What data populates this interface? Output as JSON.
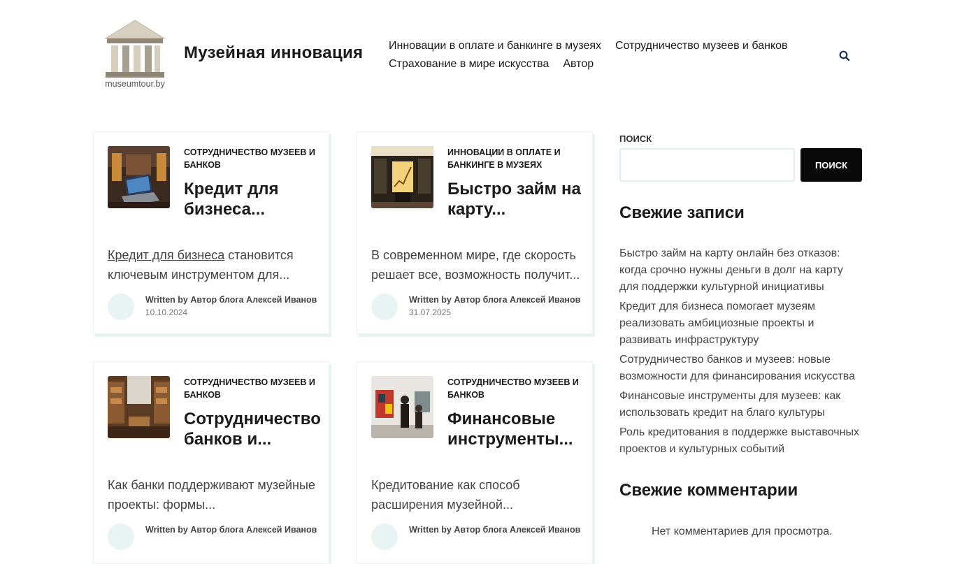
{
  "header": {
    "logo_text": "museumtour.by",
    "site_title": "Музейная инновация",
    "nav": [
      "Инновации в оплате и банкинге в музеях",
      "Сотрудничество музеев и банков",
      "Страхование в мире искусства",
      "Автор"
    ],
    "search_icon": "search-icon"
  },
  "posts": [
    {
      "category": "Сотрудничество музеев и банков",
      "title": "Кредит для бизнеса...",
      "excerpt_link": "Кредит для бизнеса",
      "excerpt": " становится ключевым инструментом для...",
      "author": "Written by Автор блога Алексей Иванов",
      "date": "10.10.2024"
    },
    {
      "category": "Инновации в оплате и банкинге в музеях",
      "title": "Быстро займ на карту...",
      "excerpt_link": "",
      "excerpt": "В современном мире, где скорость решает все, возможность получит...",
      "author": "Written by Автор блога Алексей Иванов",
      "date": "31.07.2025"
    },
    {
      "category": "Сотрудничество музеев и банков",
      "title": "Сотрудничество банков и...",
      "excerpt_link": "",
      "excerpt": "Как банки поддерживают музейные проекты: формы...",
      "author": "Written by Автор блога Алексей Иванов",
      "date": ""
    },
    {
      "category": "Сотрудничество музеев и банков",
      "title": "Финансовые инструменты...",
      "excerpt_link": "",
      "excerpt": "Кредитование как способ расширения музейной...",
      "author": "Written by Автор блога Алексей Иванов",
      "date": ""
    }
  ],
  "sidebar": {
    "search_label": "Поиск",
    "search_value": "",
    "search_button": "Поиск",
    "recent_posts_title": "Свежие записи",
    "recent_posts": [
      "Быстро займ на карту онлайн без отказов: когда срочно нужны деньги в долг на карту для поддержки культурной инициативы",
      "Кредит для бизнеса помогает музеям реализовать амбициозные проекты и развивать инфраструктуру",
      "Сотрудничество банков и музеев: новые возможности для финансирования искусства",
      "Финансовые инструменты для музеев: как использовать кредит на благо культуры",
      "Роль кредитования в поддержке выставочных проектов и культурных событий"
    ],
    "recent_comments_title": "Свежие комментарии",
    "no_comments": "Нет комментариев для просмотра."
  },
  "colors": {
    "accent_dark": "#0a0a0a",
    "card_shadow": "#e6f4f1",
    "avatar_bg": "#e8f4f3",
    "search_icon": "#1c2e5a"
  }
}
